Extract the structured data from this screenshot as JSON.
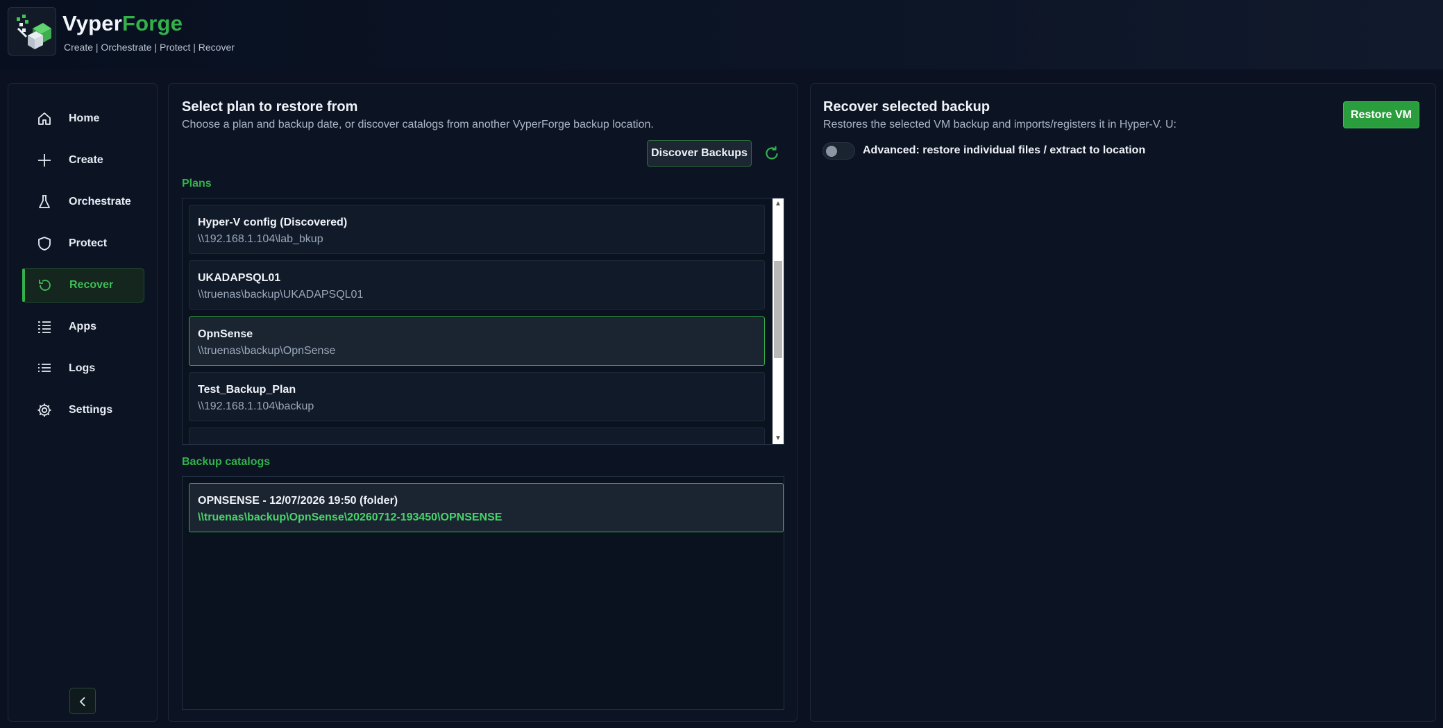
{
  "app": {
    "title_part1": "Vyper",
    "title_part2": "Forge",
    "tagline": "Create | Orchestrate | Protect | Recover"
  },
  "sidebar": {
    "items": [
      {
        "label": "Home",
        "icon": "home-icon"
      },
      {
        "label": "Create",
        "icon": "plus-icon"
      },
      {
        "label": "Orchestrate",
        "icon": "flask-icon"
      },
      {
        "label": "Protect",
        "icon": "shield-icon"
      },
      {
        "label": "Recover",
        "icon": "recover-icon",
        "active": true
      },
      {
        "label": "Apps",
        "icon": "apps-list-icon"
      },
      {
        "label": "Logs",
        "icon": "logs-list-icon"
      },
      {
        "label": "Settings",
        "icon": "gear-icon"
      }
    ]
  },
  "left_panel": {
    "title": "Select plan to restore from",
    "subtitle": "Choose a plan and backup date, or discover catalogs from another VyperForge backup location.",
    "discover_label": "Discover Backups",
    "plans_label": "Plans",
    "plans": [
      {
        "name": "Hyper-V config (Discovered)",
        "path": "\\\\192.168.1.104\\lab_bkup"
      },
      {
        "name": "UKADAPSQL01",
        "path": "\\\\truenas\\backup\\UKADAPSQL01"
      },
      {
        "name": "OpnSense",
        "path": "\\\\truenas\\backup\\OpnSense",
        "selected": true
      },
      {
        "name": "Test_Backup_Plan",
        "path": "\\\\192.168.1.104\\backup"
      }
    ],
    "catalogs_label": "Backup catalogs",
    "catalogs": [
      {
        "name": "OPNSENSE - 12/07/2026 19:50 (folder)",
        "path": "\\\\truenas\\backup\\OpnSense\\20260712-193450\\OPNSENSE"
      }
    ]
  },
  "right_panel": {
    "title": "Recover selected backup",
    "subtitle": "Restores the selected VM backup and imports/registers it in Hyper-V. U:",
    "restore_label": "Restore VM",
    "advanced_toggle_label": "Advanced: restore individual files / extract to location",
    "advanced_enabled": false
  },
  "colors": {
    "accent": "#33b24a",
    "background": "#0b1120",
    "panel": "#0c1424"
  }
}
